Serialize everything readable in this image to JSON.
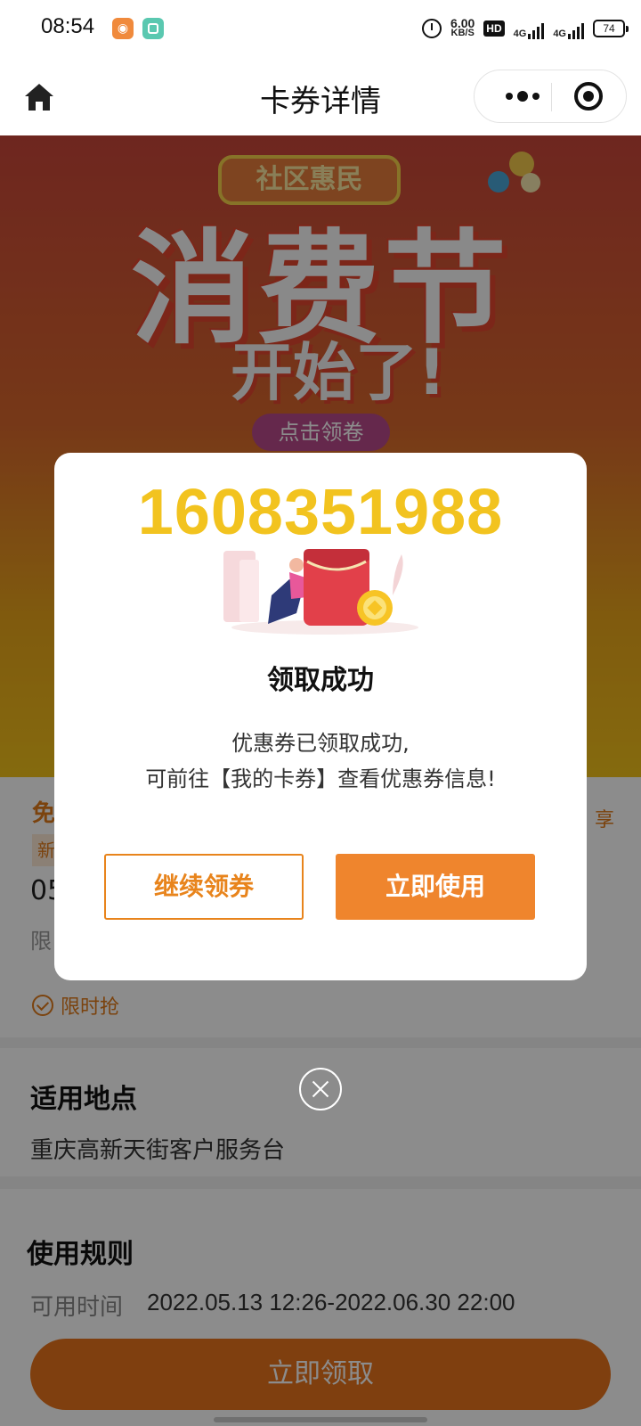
{
  "status_bar": {
    "time": "08:54",
    "net_speed_value": "6.00",
    "net_speed_unit": "KB/S",
    "hd_badge": "HD",
    "signal1": "4G",
    "signal2": "4G",
    "battery": "74"
  },
  "nav": {
    "title": "卡券详情",
    "home_icon": "home-icon",
    "more_icon": "more-dots-icon",
    "close_icon": "miniprogram-close-icon"
  },
  "banner": {
    "tag": "社区惠民",
    "headline": "消费节",
    "subline": "开始了!",
    "button": "点击领卷"
  },
  "coupon": {
    "title": "免",
    "share": "享",
    "tag": "新",
    "code_prefix": "05",
    "limit_prefix": "限",
    "flash_sale": "限时抢"
  },
  "location": {
    "heading": "适用地点",
    "value": "重庆高新天街客户服务台"
  },
  "rules": {
    "heading": "使用规则",
    "time_label": "可用时间",
    "time_value": "2022.05.13 12:26-2022.06.30 22:00"
  },
  "cta": {
    "label": "立即领取"
  },
  "modal": {
    "number": "1608351988",
    "title": "领取成功",
    "message_line1": "优惠券已领取成功,",
    "message_line2": "可前往【我的卡券】查看优惠券信息!",
    "continue_label": "继续领券",
    "use_label": "立即使用"
  },
  "colors": {
    "accent": "#ef852d",
    "number_yellow": "#f2c31f"
  }
}
